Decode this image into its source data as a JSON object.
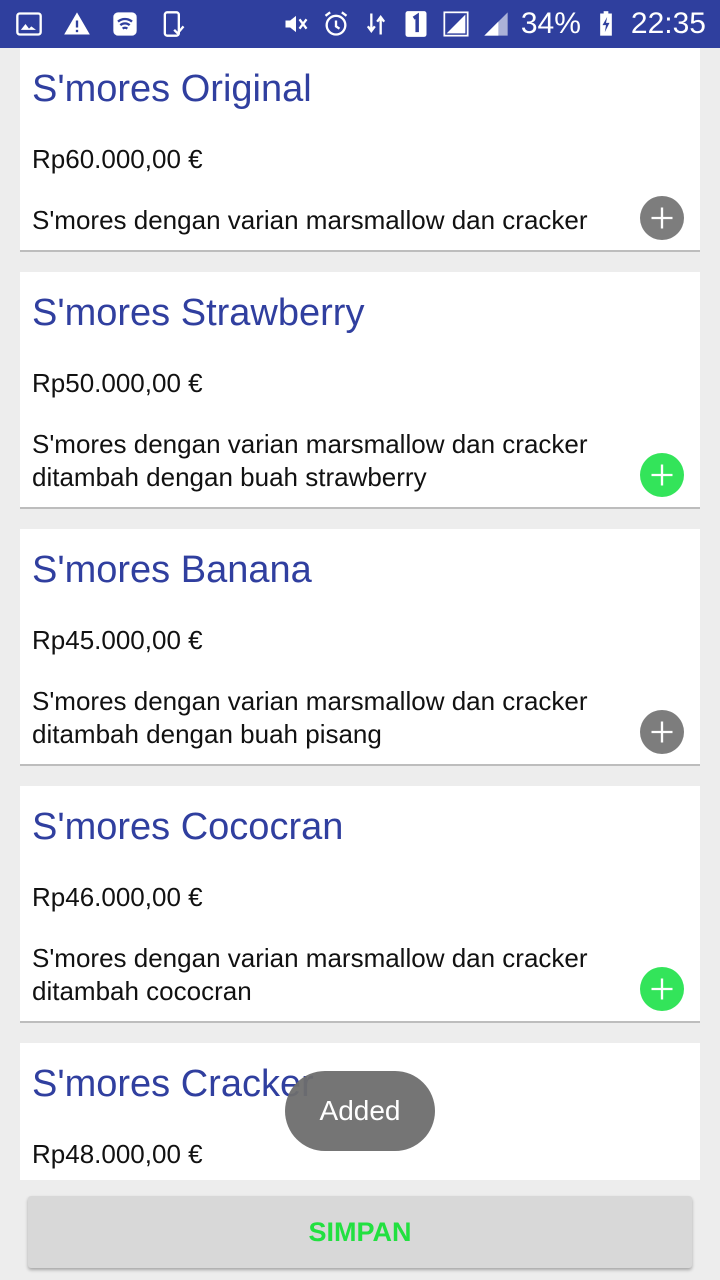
{
  "status_bar": {
    "battery": "34%",
    "time": "22:35",
    "icons": [
      "image-icon",
      "warning-icon",
      "wifi-hotspot-icon",
      "phone-check-icon",
      "mute-icon",
      "alarm-icon",
      "data-arrows-icon",
      "sim-1-icon",
      "signal-icon",
      "signal-2-icon",
      "battery-charging-icon"
    ]
  },
  "products": [
    {
      "title": "S'mores Original",
      "price": "Rp60.000,00 €",
      "description": "S'mores dengan varian marsmallow dan cracker",
      "added": false
    },
    {
      "title": "S'mores Strawberry",
      "price": "Rp50.000,00 €",
      "description": "S'mores dengan varian marsmallow dan cracker ditambah dengan buah strawberry",
      "added": true
    },
    {
      "title": "S'mores Banana",
      "price": "Rp45.000,00 €",
      "description": "S'mores dengan varian marsmallow dan cracker ditambah dengan buah pisang",
      "added": false
    },
    {
      "title": "S'mores Cococran",
      "price": "Rp46.000,00 €",
      "description": "S'mores dengan varian marsmallow dan cracker ditambah cococran",
      "added": true
    },
    {
      "title": "S'mores Cracker",
      "price": "Rp48.000,00 €"
    }
  ],
  "toast": {
    "text": "Added"
  },
  "footer": {
    "save_label": "SIMPAN"
  },
  "colors": {
    "status_bar": "#2f3f9e",
    "title": "#303f9f",
    "added": "#33e45a",
    "not_added": "#7d7d7d",
    "save_text": "#22e040"
  }
}
